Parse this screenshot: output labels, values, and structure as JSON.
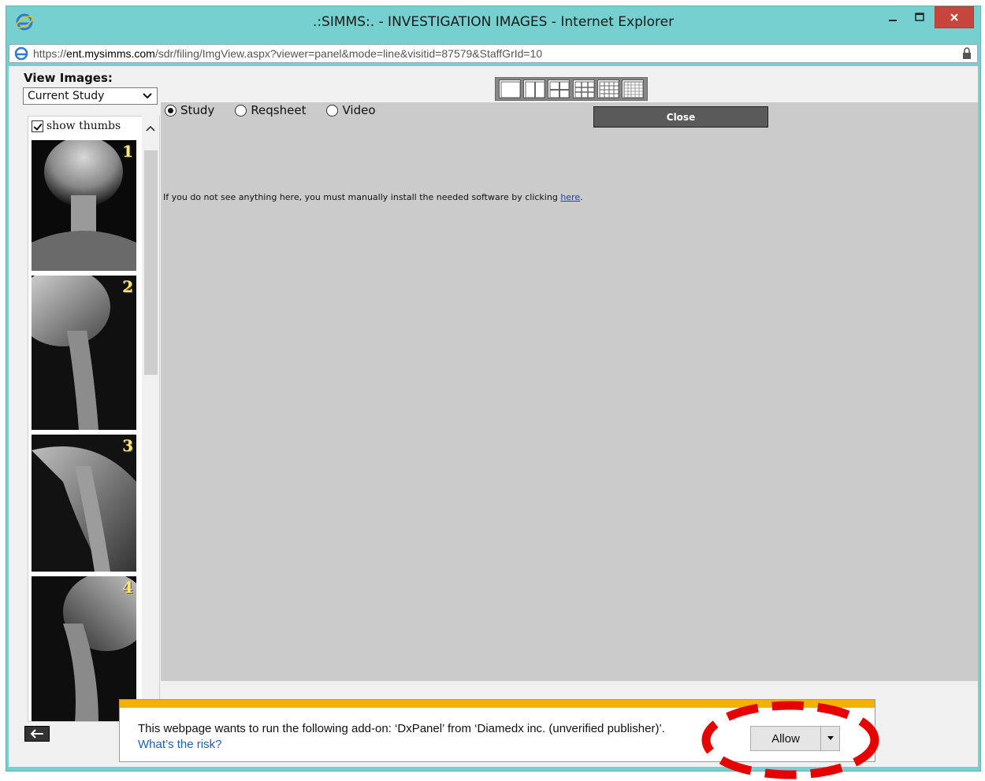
{
  "window": {
    "title": ".:SIMMS:. - INVESTIGATION IMAGES - Internet Explorer",
    "minimize_icon": "minimize-icon",
    "maximize_icon": "maximize-icon",
    "close_icon": "close-icon",
    "close_color": "#c7453d",
    "frame_color": "#76d0cf"
  },
  "address": {
    "scheme": "https://",
    "host": "ent.mysimms.com",
    "path": "/sdr/filing/ImgView.aspx?viewer=panel&mode=line&visitid=87579&StaffGrId=10"
  },
  "left": {
    "view_label": "View Images:",
    "study_select": "Current Study",
    "show_thumbs": "show thumbs",
    "thumbnails": [
      {
        "num": "1"
      },
      {
        "num": "2"
      },
      {
        "num": "3"
      },
      {
        "num": "4"
      }
    ]
  },
  "main": {
    "radios": [
      {
        "label": "Study",
        "checked": true
      },
      {
        "label": "Reqsheet",
        "checked": false
      },
      {
        "label": "Video",
        "checked": false
      }
    ],
    "close_label": "Close",
    "info_prefix": "If you do not see anything here, you must manually install the needed software by clicking ",
    "info_link": "here",
    "info_suffix": ".",
    "layouts": [
      "layout-1x1-icon",
      "layout-1x2-icon",
      "layout-2x2-icon",
      "layout-3x3-icon",
      "layout-4x4-icon",
      "layout-5x5-icon"
    ]
  },
  "notification": {
    "message": "This webpage wants to run the following add-on: ‘DxPanel’ from ‘Diamedx inc. (unverified publisher)’.",
    "link": "What’s the risk?",
    "allow_label": "Allow",
    "accent": "#f1b300"
  },
  "annotation": {
    "color": "#e60000"
  }
}
